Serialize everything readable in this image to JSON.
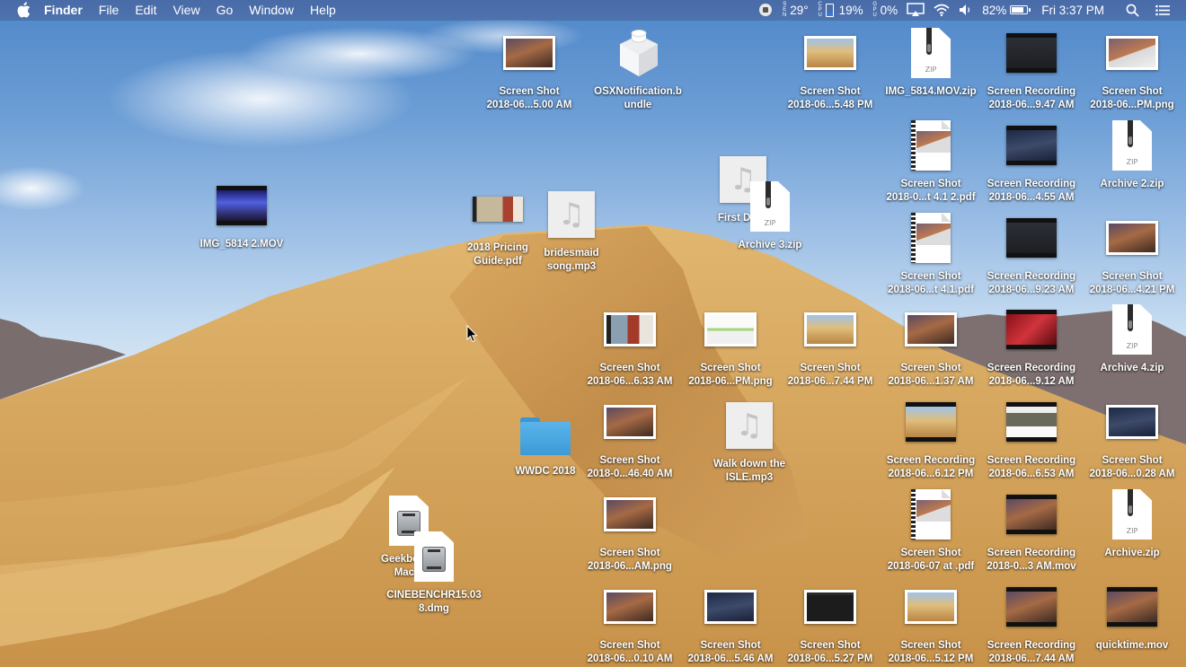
{
  "menubar": {
    "apple_menu": "apple-logo",
    "app_name": "Finder",
    "menus": [
      "File",
      "Edit",
      "View",
      "Go",
      "Window",
      "Help"
    ],
    "status": {
      "record_icon": "record-stop-icon",
      "sensor_label": "SEN",
      "temperature": "29°",
      "cpu_label": "CPU",
      "cpu_percent": "19%",
      "cpu_fill": 0.19,
      "gpu_label": "GPU",
      "gpu_percent": "0%",
      "airplay_icon": "airplay-icon",
      "wifi_icon": "wifi-icon",
      "volume_icon": "volume-icon",
      "battery_percent": "82%",
      "battery_level": 0.82,
      "clock": "Fri 3:37 PM",
      "spotlight_icon": "search-icon",
      "notification_icon": "notification-center-icon"
    }
  },
  "desktop": {
    "icons": [
      {
        "id": "ss-500am",
        "kind": "screenshot",
        "lines": [
          "Screen Shot",
          "2018-06...5.00 AM"
        ],
        "tint": "mojave-dark"
      },
      {
        "id": "osxnotification",
        "kind": "bundle",
        "lines": [
          "OSXNotification.b",
          "undle"
        ]
      },
      {
        "id": "ss-548pm",
        "kind": "screenshot",
        "lines": [
          "Screen Shot",
          "2018-06...5.48 PM"
        ],
        "tint": "mojave-light"
      },
      {
        "id": "img5814-zip",
        "kind": "zip",
        "lines": [
          "IMG_5814.MOV.zip"
        ],
        "badge": "ZIP"
      },
      {
        "id": "rec-947am",
        "kind": "video",
        "lines": [
          "Screen Recording",
          "2018-06...9.47 AM"
        ],
        "tint": "dark-window"
      },
      {
        "id": "ss-pm-png-1",
        "kind": "screenshot",
        "lines": [
          "Screen Shot",
          "2018-06...PM.png"
        ],
        "tint": "mojave-window"
      },
      {
        "id": "ss-pdf-412",
        "kind": "pdf",
        "lines": [
          "Screen Shot",
          "2018-0...t 4.1 2.pdf"
        ]
      },
      {
        "id": "rec-455am",
        "kind": "video",
        "lines": [
          "Screen Recording",
          "2018-06...4.55 AM"
        ],
        "tint": "mojave-night"
      },
      {
        "id": "archive2",
        "kind": "zip",
        "lines": [
          "Archive 2.zip"
        ],
        "badge": "ZIP"
      },
      {
        "id": "img5814-2",
        "kind": "video",
        "lines": [
          "IMG_5814 2.MOV"
        ],
        "tint": "concert"
      },
      {
        "id": "pricing-guide",
        "kind": "pdf-wide",
        "lines": [
          "2018 Pricing",
          "Guide.pdf"
        ]
      },
      {
        "id": "bridesmaid-song",
        "kind": "music",
        "lines": [
          "bridesmaid",
          "song.mp3"
        ]
      },
      {
        "id": "first-dance",
        "kind": "music",
        "lines": [
          "First Danc"
        ]
      },
      {
        "id": "archive3",
        "kind": "zip",
        "lines": [
          "Archive 3.zip"
        ],
        "badge": "ZIP"
      },
      {
        "id": "ss-pdf-41",
        "kind": "pdf",
        "lines": [
          "Screen Shot",
          "2018-06...t 4.1.pdf"
        ]
      },
      {
        "id": "rec-923am",
        "kind": "video",
        "lines": [
          "Screen Recording",
          "2018-06...9.23 AM"
        ],
        "tint": "dark-window"
      },
      {
        "id": "ss-421pm",
        "kind": "screenshot",
        "lines": [
          "Screen Shot",
          "2018-06...4.21 PM"
        ],
        "tint": "mojave-dark"
      },
      {
        "id": "ss-633am",
        "kind": "screenshot",
        "lines": [
          "Screen Shot",
          "2018-06...6.33 AM"
        ],
        "tint": "wedding"
      },
      {
        "id": "ss-pm-png-2",
        "kind": "screenshot",
        "lines": [
          "Screen Shot",
          "2018-06...PM.png"
        ],
        "tint": "form"
      },
      {
        "id": "ss-744pm",
        "kind": "screenshot",
        "lines": [
          "Screen Shot",
          "2018-06...7.44 PM"
        ],
        "tint": "mojave-light"
      },
      {
        "id": "ss-137am",
        "kind": "screenshot",
        "lines": [
          "Screen Shot",
          "2018-06...1.37 AM"
        ],
        "tint": "mojave-dark"
      },
      {
        "id": "rec-912am",
        "kind": "video",
        "lines": [
          "Screen Recording",
          "2018-06...9.12 AM"
        ],
        "tint": "red-photos"
      },
      {
        "id": "archive4",
        "kind": "zip",
        "lines": [
          "Archive 4.zip"
        ],
        "badge": "ZIP"
      },
      {
        "id": "wwdc-2018",
        "kind": "folder",
        "lines": [
          "WWDC 2018"
        ]
      },
      {
        "id": "ss-4640am",
        "kind": "screenshot",
        "lines": [
          "Screen Shot",
          "2018-0...46.40 AM"
        ],
        "tint": "mojave-dark"
      },
      {
        "id": "walk-down-isle",
        "kind": "music",
        "lines": [
          "Walk down the",
          "ISLE.mp3"
        ]
      },
      {
        "id": "rec-612pm",
        "kind": "video",
        "lines": [
          "Screen Recording",
          "2018-06...6.12 PM"
        ],
        "tint": "mojave-light"
      },
      {
        "id": "rec-653am",
        "kind": "video",
        "lines": [
          "Screen Recording",
          "2018-06...6.53 AM"
        ],
        "tint": "youtube"
      },
      {
        "id": "ss-028am",
        "kind": "screenshot",
        "lines": [
          "Screen Shot",
          "2018-06...0.28 AM"
        ],
        "tint": "mojave-night"
      },
      {
        "id": "geekbench",
        "kind": "dmg",
        "lines": [
          "Geekbench",
          "Mac.d"
        ]
      },
      {
        "id": "cinebench",
        "kind": "dmg",
        "lines": [
          "CINEBENCHR15.03",
          "8.dmg"
        ]
      },
      {
        "id": "ss-am-png",
        "kind": "screenshot",
        "lines": [
          "Screen Shot",
          "2018-06...AM.png"
        ],
        "tint": "mojave-dark"
      },
      {
        "id": "ss-pdf-0607",
        "kind": "pdf",
        "lines": [
          "Screen Shot",
          "2018-06-07 at .pdf"
        ]
      },
      {
        "id": "rec-3am-mov",
        "kind": "video",
        "lines": [
          "Screen Recording",
          "2018-0...3 AM.mov"
        ],
        "tint": "mojave-dark"
      },
      {
        "id": "archive",
        "kind": "zip",
        "lines": [
          "Archive.zip"
        ],
        "badge": "ZIP"
      },
      {
        "id": "ss-010am",
        "kind": "screenshot",
        "lines": [
          "Screen Shot",
          "2018-06...0.10 AM"
        ],
        "tint": "mojave-dark"
      },
      {
        "id": "ss-546am",
        "kind": "screenshot",
        "lines": [
          "Screen Shot",
          "2018-06...5.46 AM"
        ],
        "tint": "mojave-night"
      },
      {
        "id": "ss-527pm",
        "kind": "screenshot",
        "lines": [
          "Screen Shot",
          "2018-06...5.27 PM"
        ],
        "tint": "terminal"
      },
      {
        "id": "ss-512pm",
        "kind": "screenshot",
        "lines": [
          "Screen Shot",
          "2018-06...5.12 PM"
        ],
        "tint": "mojave-light"
      },
      {
        "id": "rec-744am",
        "kind": "video",
        "lines": [
          "Screen Recording",
          "2018-06...7.44 AM"
        ],
        "tint": "mojave-dark"
      },
      {
        "id": "quicktime",
        "kind": "video",
        "lines": [
          "quicktime.mov"
        ],
        "tint": "mojave-dark"
      }
    ]
  },
  "cursor": "arrow-pointer"
}
